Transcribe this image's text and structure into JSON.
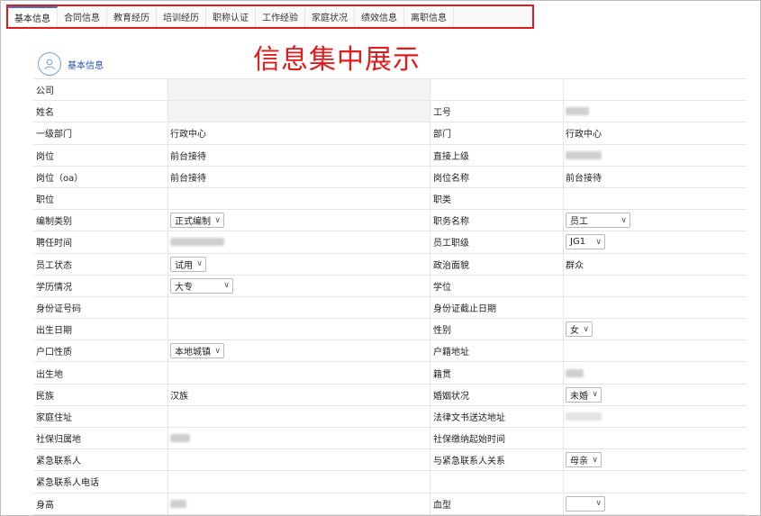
{
  "tabs": [
    {
      "label": "基本信息"
    },
    {
      "label": "合同信息"
    },
    {
      "label": "教育经历"
    },
    {
      "label": "培训经历"
    },
    {
      "label": "职称认证"
    },
    {
      "label": "工作经验"
    },
    {
      "label": "家庭状况"
    },
    {
      "label": "绩效信息"
    },
    {
      "label": "离职信息"
    }
  ],
  "headline": "信息集中展示",
  "user_chip": {
    "label": "基本信息",
    "icon": "user-icon"
  },
  "rows": [
    {
      "l1": "公司",
      "v1": "",
      "l2": "",
      "v2": ""
    },
    {
      "l1": "姓名",
      "v1": "",
      "l2": "工号",
      "v2": ""
    },
    {
      "l1": "一级部门",
      "v1": "行政中心",
      "l2": "部门",
      "v2": "行政中心"
    },
    {
      "l1": "岗位",
      "v1": "前台接待",
      "l2": "直接上级",
      "v2": ""
    },
    {
      "l1": "岗位（oa）",
      "v1": "前台接待",
      "l2": "岗位名称",
      "v2": "前台接待"
    },
    {
      "l1": "职位",
      "v1": "",
      "l2": "职类",
      "v2": ""
    },
    {
      "l1": "编制类别",
      "v1": "正式编制",
      "l2": "职务名称",
      "v2": "员工"
    },
    {
      "l1": "聘任时间",
      "v1": "",
      "l2": "员工职级",
      "v2": "JG1"
    },
    {
      "l1": "员工状态",
      "v1": "试用",
      "l2": "政治面貌",
      "v2": "群众"
    },
    {
      "l1": "学历情况",
      "v1": "大专",
      "l2": "学位",
      "v2": ""
    },
    {
      "l1": "身份证号码",
      "v1": "",
      "l2": "身份证截止日期",
      "v2": ""
    },
    {
      "l1": "出生日期",
      "v1": "",
      "l2": "性别",
      "v2": "女"
    },
    {
      "l1": "户口性质",
      "v1": "本地城镇",
      "l2": "户籍地址",
      "v2": ""
    },
    {
      "l1": "出生地",
      "v1": "",
      "l2": "籍贯",
      "v2": ""
    },
    {
      "l1": "民族",
      "v1": "汉族",
      "l2": "婚姻状况",
      "v2": "未婚"
    },
    {
      "l1": "家庭住址",
      "v1": "",
      "l2": "法律文书送达地址",
      "v2": ""
    },
    {
      "l1": "社保归属地",
      "v1": "",
      "l2": "社保缴纳起始时间",
      "v2": ""
    },
    {
      "l1": "紧急联系人",
      "v1": "",
      "l2": "与紧急联系人关系",
      "v2": "母亲"
    },
    {
      "l1": "紧急联系人电话",
      "v1": "",
      "l2": "",
      "v2": ""
    },
    {
      "l1": "身高",
      "v1": "",
      "l2": "血型",
      "v2": ""
    }
  ]
}
